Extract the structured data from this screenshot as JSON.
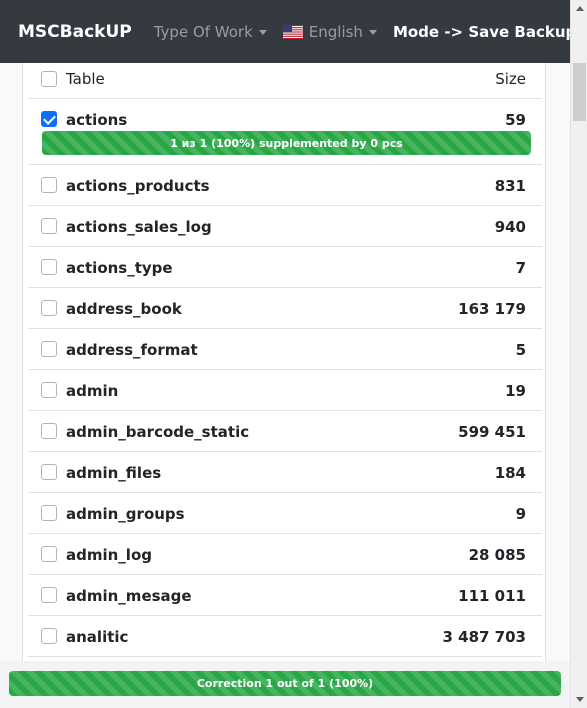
{
  "navbar": {
    "brand": "MSCBackUP",
    "type_of_work": "Type Of Work",
    "language": "English",
    "language_flag": "us-flag-icon",
    "mode": "Mode -> Save Backup"
  },
  "table": {
    "header": {
      "name": "Table",
      "size": "Size"
    },
    "rows": [
      {
        "name": "actions",
        "size": "59",
        "checked": true,
        "progress_label": "1 из 1 (100%) supplemented by 0 pcs",
        "progress": 100
      },
      {
        "name": "actions_products",
        "size": "831",
        "checked": false
      },
      {
        "name": "actions_sales_log",
        "size": "940",
        "checked": false
      },
      {
        "name": "actions_type",
        "size": "7",
        "checked": false
      },
      {
        "name": "address_book",
        "size": "163 179",
        "checked": false
      },
      {
        "name": "address_format",
        "size": "5",
        "checked": false
      },
      {
        "name": "admin",
        "size": "19",
        "checked": false
      },
      {
        "name": "admin_barcode_static",
        "size": "599 451",
        "checked": false
      },
      {
        "name": "admin_files",
        "size": "184",
        "checked": false
      },
      {
        "name": "admin_groups",
        "size": "9",
        "checked": false
      },
      {
        "name": "admin_log",
        "size": "28 085",
        "checked": false
      },
      {
        "name": "admin_mesage",
        "size": "111 011",
        "checked": false
      },
      {
        "name": "analitic",
        "size": "3 487 703",
        "checked": false
      }
    ]
  },
  "footer": {
    "progress_label": "Correction 1 out of 1 (100%)",
    "progress": 100
  },
  "colors": {
    "navbar": "#343a40",
    "progress": "#28a745",
    "checkbox_checked": "#0d6efd"
  }
}
